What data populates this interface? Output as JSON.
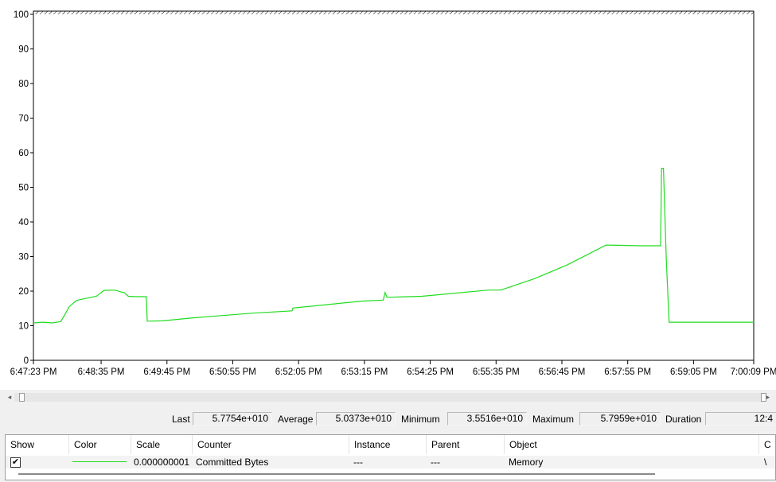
{
  "chart_data": {
    "type": "line",
    "title": "",
    "xlabel": "",
    "ylabel": "",
    "ylim": [
      0,
      100
    ],
    "yticks": [
      0,
      10,
      20,
      30,
      40,
      50,
      60,
      70,
      80,
      90,
      100
    ],
    "xlim": [
      "6:47:23 PM",
      "7:00:09 PM"
    ],
    "xticks": [
      "6:47:23 PM",
      "6:48:35 PM",
      "6:49:45 PM",
      "6:50:55 PM",
      "6:52:05 PM",
      "6:53:15 PM",
      "6:54:25 PM",
      "6:55:35 PM",
      "6:56:45 PM",
      "6:57:55 PM",
      "6:59:05 PM",
      "7:00:09 PM"
    ],
    "grid": false,
    "series": [
      {
        "name": "Committed Bytes",
        "color": "#1fdc1f",
        "points": [
          [
            "6:47:23 PM",
            10.8
          ],
          [
            "6:47:33 PM",
            11.0
          ],
          [
            "6:47:43 PM",
            10.8
          ],
          [
            "6:47:52 PM",
            11.2
          ],
          [
            "6:47:57 PM",
            13.5
          ],
          [
            "6:48:01 PM",
            15.5
          ],
          [
            "6:48:09 PM",
            17.3
          ],
          [
            "6:48:19 PM",
            17.9
          ],
          [
            "6:48:30 PM",
            18.5
          ],
          [
            "6:48:38 PM",
            20.2
          ],
          [
            "6:48:49 PM",
            20.3
          ],
          [
            "6:49:00 PM",
            19.5
          ],
          [
            "6:49:04 PM",
            18.5
          ],
          [
            "6:49:12 PM",
            18.4
          ],
          [
            "6:49:23 PM",
            18.4
          ],
          [
            "6:49:24 PM",
            11.3
          ],
          [
            "6:49:40 PM",
            11.4
          ],
          [
            "6:50:14 PM",
            12.3
          ],
          [
            "6:51:15 PM",
            13.6
          ],
          [
            "6:51:58 PM",
            14.3
          ],
          [
            "6:51:59 PM",
            15.1
          ],
          [
            "6:53:12 PM",
            17.1
          ],
          [
            "6:53:35 PM",
            17.4
          ],
          [
            "6:53:37 PM",
            19.6
          ],
          [
            "6:53:39 PM",
            18.2
          ],
          [
            "6:54:16 PM",
            18.5
          ],
          [
            "6:55:27 PM",
            20.3
          ],
          [
            "6:55:40 PM",
            20.3
          ],
          [
            "6:56:16 PM",
            23.6
          ],
          [
            "6:56:50 PM",
            27.5
          ],
          [
            "6:57:32 PM",
            33.3
          ],
          [
            "6:58:10 PM",
            33.1
          ],
          [
            "6:58:30 PM",
            33.1
          ],
          [
            "6:58:31 PM",
            55.5
          ],
          [
            "6:58:33 PM",
            55.5
          ],
          [
            "6:58:36 PM",
            29.5
          ],
          [
            "6:58:39 PM",
            11.0
          ],
          [
            "7:00:09 PM",
            11.0
          ]
        ]
      }
    ]
  },
  "stats": {
    "last_label": "Last",
    "last_value": "5.7754e+010",
    "average_label": "Average",
    "average_value": "5.0373e+010",
    "minimum_label": "Minimum",
    "minimum_value": "3.5516e+010",
    "maximum_label": "Maximum",
    "maximum_value": "5.7959e+010",
    "duration_label": "Duration",
    "duration_value": "12:4"
  },
  "counter_list": {
    "headers": [
      "Show",
      "Color",
      "Scale",
      "Counter",
      "Instance",
      "Parent",
      "Object",
      "C"
    ],
    "rows": [
      {
        "show": "✔",
        "color": "#1fdc1f",
        "scale": "0.000000001",
        "counter": "Committed Bytes",
        "instance": "---",
        "parent": "---",
        "object": "Memory",
        "computer": "\\"
      }
    ]
  },
  "scrollbar": {
    "left_arrow": "◂",
    "right_arrow": "▸"
  }
}
